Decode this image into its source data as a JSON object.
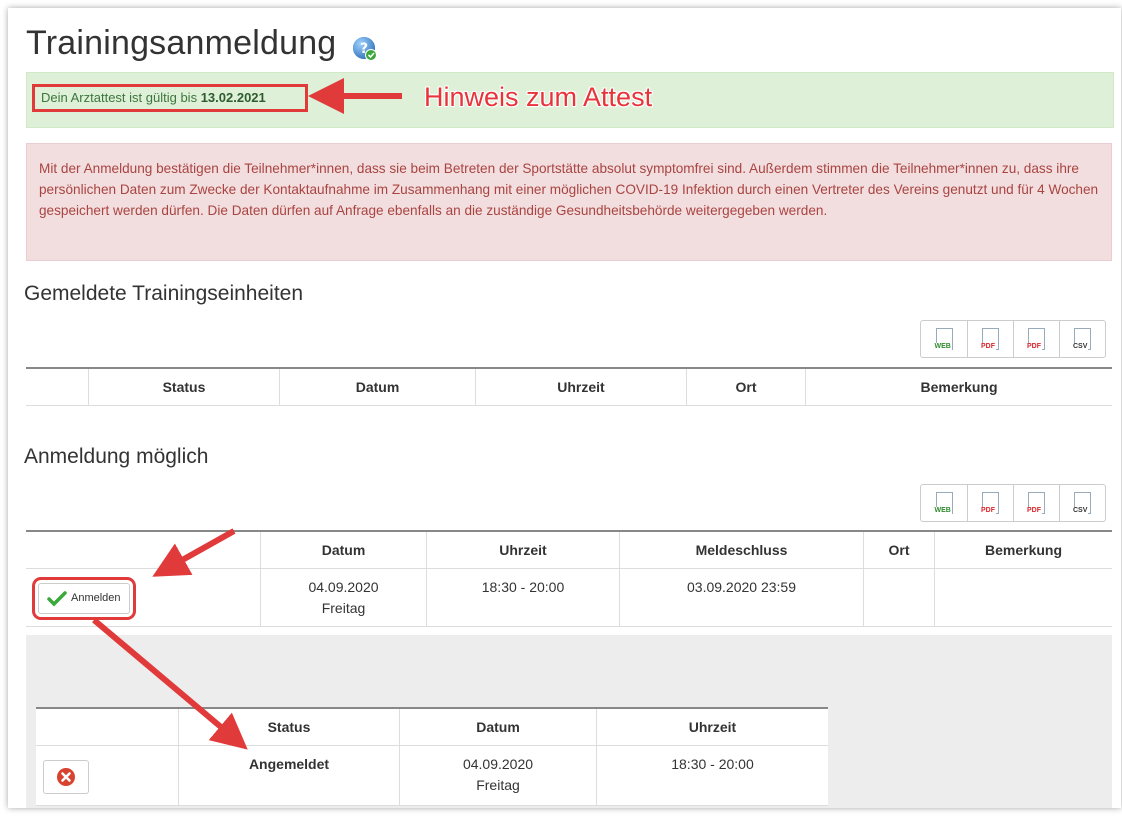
{
  "page": {
    "title": "Trainingsanmeldung",
    "help_icon": "help-icon"
  },
  "attest": {
    "text_prefix": "Dein Arztattest ist gültig bis",
    "date": "13.02.2021",
    "annotation": "Hinweis zum Attest"
  },
  "covid_notice": "Mit der Anmeldung bestätigen die Teilnehmer*innen, dass sie beim Betreten der Sportstätte absolut symptomfrei sind. Außerdem stimmen die Teilnehmer*innen zu, dass ihre persönlichen Daten zum Zwecke der Kontaktaufnahme im Zusammenhang mit einer möglichen COVID-19 Infektion durch einen Vertreter des Vereins genutzt und für 4 Wochen gespeichert werden dürfen. Die Daten dürfen auf Anfrage ebenfalls an die zuständige Gesundheitsbehörde weitergegeben werden.",
  "export_buttons": [
    {
      "label": "WEB",
      "color": "#2e8b2e",
      "icon": "web-export-icon"
    },
    {
      "label": "PDF",
      "color": "#d9262c",
      "icon": "pdf-export-icon"
    },
    {
      "label": "PDF",
      "color": "#d9262c",
      "icon": "pdf-export-icon"
    },
    {
      "label": "CSV",
      "color": "#333333",
      "icon": "csv-export-icon"
    }
  ],
  "registered": {
    "heading": "Gemeldete Trainingseinheiten",
    "columns": [
      "",
      "Status",
      "Datum",
      "Uhrzeit",
      "Ort",
      "Bemerkung"
    ]
  },
  "available": {
    "heading": "Anmeldung möglich",
    "columns": [
      "",
      "Datum",
      "Uhrzeit",
      "Meldeschluss",
      "Ort",
      "Bemerkung"
    ],
    "row": {
      "button": "Anmelden",
      "date": "04.09.2020",
      "weekday": "Freitag",
      "time": "18:30 - 20:00",
      "deadline": "03.09.2020 23:59",
      "place": "",
      "remark": ""
    }
  },
  "result": {
    "columns": [
      "",
      "Status",
      "Datum",
      "Uhrzeit"
    ],
    "row": {
      "status": "Angemeldet",
      "date": "04.09.2020",
      "weekday": "Freitag",
      "time": "18:30 - 20:00"
    }
  },
  "colors": {
    "annotation_red": "#e03a3a",
    "success_green": "#2e9a2e",
    "alert_green_bg": "#dff0d8",
    "alert_red_bg": "#f2dede"
  }
}
